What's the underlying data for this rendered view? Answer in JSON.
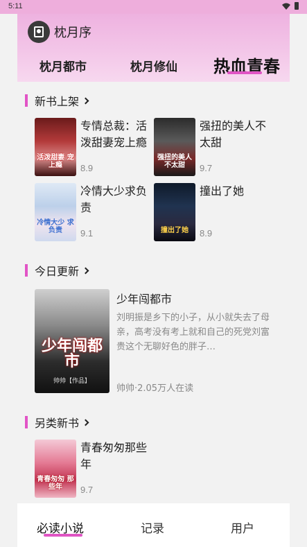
{
  "status_bar": {
    "time": "5:11"
  },
  "header": {
    "app_title": "枕月序",
    "tabs": [
      {
        "label": "枕月都市"
      },
      {
        "label": "枕月修仙"
      },
      {
        "label": "热血青春",
        "active": true
      }
    ]
  },
  "sections": [
    {
      "title": "新书上架",
      "books": [
        {
          "title": "专情总裁：活泼甜妻宠上瘾",
          "score": "8.9",
          "cover_text": "活泼甜妻 宠上瘾"
        },
        {
          "title": "强扭的美人不太甜",
          "score": "9.7",
          "cover_text": "强扭的美人 不太甜"
        },
        {
          "title": "冷情大少求负责",
          "score": "9.1",
          "cover_text": "冷情大少 求负责"
        },
        {
          "title": "撞出了她",
          "score": "8.9",
          "cover_text": "撞出了她"
        }
      ]
    },
    {
      "title": "今日更新",
      "featured": {
        "title": "少年闯都市",
        "description": "刘明振是乡下的小子，从小就失去了母亲，高考没有考上就和自己的死党刘富贵这个无聊好色的胖子…",
        "meta": "帅帅·2.05万人在读",
        "cover_text": "少年闯都市",
        "cover_author": "帅帅【作品】"
      }
    },
    {
      "title": "另类新书",
      "books": [
        {
          "title": "青春匆匆那些年",
          "score": "9.7",
          "cover_text": "青春匆匆 那些年"
        }
      ]
    }
  ],
  "bottom_nav": {
    "items": [
      {
        "label": "必读小说",
        "active": true
      },
      {
        "label": "记录"
      },
      {
        "label": "用户"
      }
    ]
  },
  "colors": {
    "accent": "#e054c4",
    "header_pink": "#eeb2e0"
  }
}
